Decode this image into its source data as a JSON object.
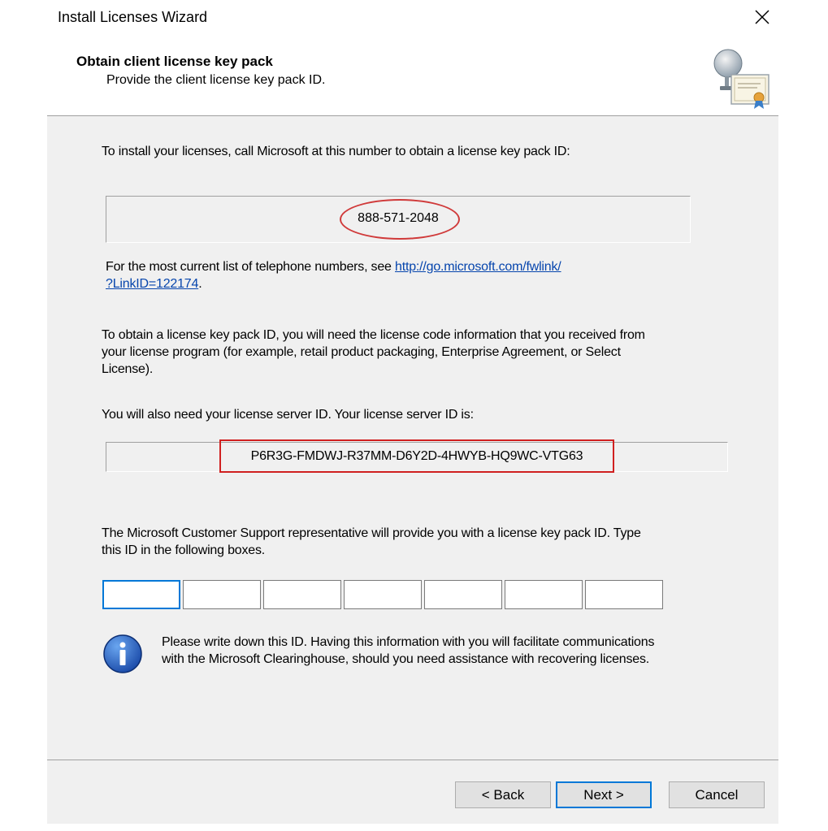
{
  "window": {
    "title": "Install Licenses Wizard",
    "close_glyph": "×"
  },
  "header": {
    "title": "Obtain client license key pack",
    "subtitle": "Provide the client license key pack ID.",
    "icon": "license-certificate-icon"
  },
  "body": {
    "intro": "To install your licenses, call Microsoft at this number to obtain a license key pack ID:",
    "phone_number": "888-571-2048",
    "phone_list_prefix": "For the most current list of telephone numbers, see ",
    "phone_list_link_line1": "http://go.microsoft.com/fwlink/",
    "phone_list_link_line2": "?LinkID=122174",
    "phone_list_suffix": ".",
    "license_code_line1": "To obtain a license key pack ID, you will need the license code information that you received from",
    "license_code_line2": "your license program (for example, retail product packaging, Enterprise Agreement, or Select",
    "license_code_line3": "License).",
    "server_id_label": "You will also need your license server ID. Your license server ID is:",
    "server_id": "P6R3G-FMDWJ-R37MM-D6Y2D-4HWYB-HQ9WC-VTG63",
    "support_line1": "The Microsoft Customer Support representative will provide you with a license key pack ID. Type",
    "support_line2": "this ID in the following boxes.",
    "key_boxes": [
      "",
      "",
      "",
      "",
      "",
      "",
      ""
    ],
    "note_line1": "Please write down this ID. Having this information with you will facilitate communications",
    "note_line2": "with the Microsoft Clearinghouse, should you need assistance with recovering licenses.",
    "note_icon": "info-icon",
    "annotation_color": "#d03a3a"
  },
  "footer": {
    "back_label": "< Back",
    "next_label": "Next >",
    "cancel_label": "Cancel"
  }
}
